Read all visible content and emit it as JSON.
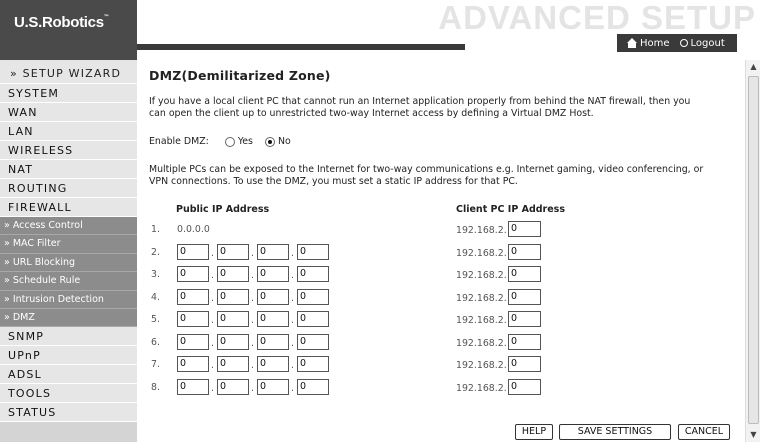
{
  "header": {
    "logo": "U.S.Robotics",
    "title": "ADVANCED SETUP",
    "home_label": "Home",
    "logout_label": "Logout"
  },
  "sidebar": {
    "wizard": "» SETUP WIZARD",
    "items": [
      "SYSTEM",
      "WAN",
      "LAN",
      "WIRELESS",
      "NAT",
      "ROUTING",
      "FIREWALL"
    ],
    "subitems": [
      "» Access Control",
      "» MAC Filter",
      "» URL Blocking",
      "» Schedule Rule",
      "» Intrusion Detection",
      "» DMZ"
    ],
    "items_after": [
      "SNMP",
      "UPnP",
      "ADSL",
      "TOOLS",
      "STATUS"
    ]
  },
  "main": {
    "title": "DMZ(Demilitarized Zone)",
    "intro_line1": "If you have a local client PC that cannot run an Internet application properly from behind the NAT firewall, then you",
    "intro_line2": "can open the client up to unrestricted two-way Internet access by defining a Virtual DMZ Host.",
    "enable_label": "Enable DMZ:",
    "yes_label": "Yes",
    "no_label": "No",
    "enable_value": "No",
    "multi_line1": "Multiple PCs can be exposed to the Internet for two-way communications e.g. Internet gaming, video conferencing, or",
    "multi_line2": "VPN connections.  To use the DMZ, you must set a static IP address for that PC.",
    "public_ip_header": "Public IP Address",
    "client_ip_header": "Client PC IP Address",
    "row1_public": "0.0.0.0",
    "client_prefix": "192.168.2.",
    "rows": [
      {
        "num": "1.",
        "ip": [
          "",
          "",
          "",
          ""
        ],
        "client": "0"
      },
      {
        "num": "2.",
        "ip": [
          "0",
          "0",
          "0",
          "0"
        ],
        "client": "0"
      },
      {
        "num": "3.",
        "ip": [
          "0",
          "0",
          "0",
          "0"
        ],
        "client": "0"
      },
      {
        "num": "4.",
        "ip": [
          "0",
          "0",
          "0",
          "0"
        ],
        "client": "0"
      },
      {
        "num": "5.",
        "ip": [
          "0",
          "0",
          "0",
          "0"
        ],
        "client": "0"
      },
      {
        "num": "6.",
        "ip": [
          "0",
          "0",
          "0",
          "0"
        ],
        "client": "0"
      },
      {
        "num": "7.",
        "ip": [
          "0",
          "0",
          "0",
          "0"
        ],
        "client": "0"
      },
      {
        "num": "8.",
        "ip": [
          "0",
          "0",
          "0",
          "0"
        ],
        "client": "0"
      }
    ],
    "help_label": "HELP",
    "save_label": "SAVE SETTINGS",
    "cancel_label": "CANCEL"
  }
}
